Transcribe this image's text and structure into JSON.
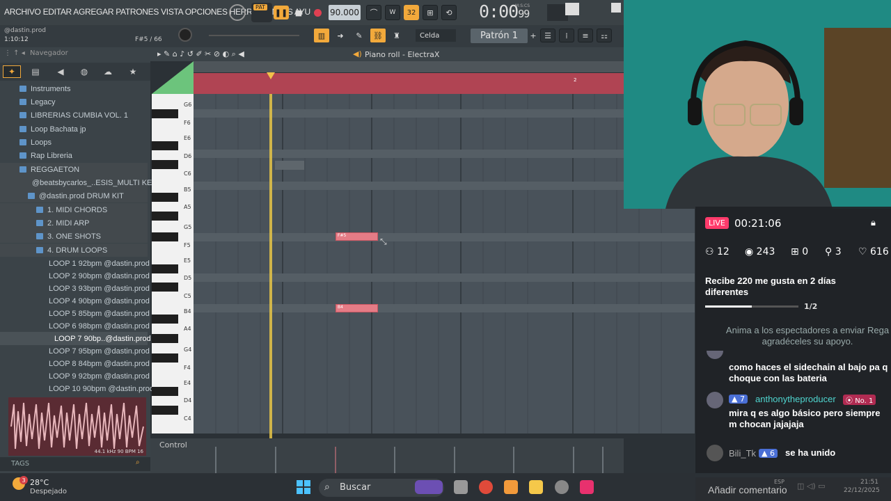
{
  "menubar": {
    "menu_text": "ARCHIVO EDITAR AGREGAR PATRONES VISTA OPCIONES HERRAMIENTAS AYU",
    "pat_label": "PAT",
    "tempo": "90.000",
    "time": "0:00",
    "time_frac": "99",
    "time_unit": "M:S:CS"
  },
  "hint": {
    "title": "@dastin.prod",
    "position": "1:10:12",
    "key": "F#5 / 66"
  },
  "toolbar2": {
    "snap": "Celda",
    "pattern": "Patrón 1"
  },
  "browser": {
    "title": "Navegador",
    "items": [
      {
        "label": "Instruments"
      },
      {
        "label": "Legacy"
      },
      {
        "label": "LIBRERIAS CUMBIA VOL. 1"
      },
      {
        "label": "Loop Bachata jp"
      },
      {
        "label": "Loops"
      },
      {
        "label": "Rap Libreria"
      },
      {
        "label": "REGGAETON"
      },
      {
        "label": "@beatsbycarlos_..ESIS_MULTI KEY"
      },
      {
        "label": "@dastin.prod DRUM KIT"
      },
      {
        "label": "1. MIDI CHORDS"
      },
      {
        "label": "2. MIDI ARP"
      },
      {
        "label": "3. ONE SHOTS"
      },
      {
        "label": "4. DRUM LOOPS"
      },
      {
        "label": "LOOP 1 92bpm @dastin.prod"
      },
      {
        "label": "LOOP 2 90bpm @dastin.prod"
      },
      {
        "label": "LOOP 3 93bpm @dastin.prod"
      },
      {
        "label": "LOOP 4 90bpm @dastin.prod"
      },
      {
        "label": "LOOP 5 85bpm @dastin.prod"
      },
      {
        "label": "LOOP 6 98bpm @dastin.prod"
      },
      {
        "label": "LOOP 7 90bp..@dastin.prod"
      },
      {
        "label": "LOOP 7 95bpm @dastin.prod"
      },
      {
        "label": "LOOP 8 84bpm @dastin.prod"
      },
      {
        "label": "LOOP 9 92bpm @dastin.prod"
      },
      {
        "label": "LOOP 10 90bpm @dastin.prod"
      }
    ],
    "wave_info": "44.1 kHz 90 BPM 16",
    "tags_label": "TAGS"
  },
  "piano_roll": {
    "title": "Piano roll - ElectraX",
    "bar_marker": "2",
    "key_labels": [
      "G6",
      "F6",
      "E6",
      "D6",
      "C6",
      "B5",
      "A5",
      "G5",
      "F5",
      "E5",
      "D5",
      "C5",
      "B4",
      "A4",
      "G4",
      "F4",
      "E4",
      "D4",
      "C4"
    ],
    "notes": [
      {
        "label": "F#5"
      },
      {
        "label": "B4"
      }
    ],
    "control_label": "Control"
  },
  "live": {
    "badge": "LIVE",
    "time": "00:21:06",
    "viewers_online": "12",
    "views": "243",
    "gifts": "0",
    "follows": "3",
    "likes": "616",
    "goal_title": "Recibe 220 me gusta en 2 días diferentes",
    "goal_progress": 0.5,
    "goal_count": "1/2",
    "invite_text": "Anima a los espectadores a enviar Rega agradéceles su apoyo.",
    "comments": [
      {
        "user": "",
        "text": "como haces el sidechain al bajo pa q choque con las bateria"
      },
      {
        "user": "anthonytheproducer",
        "level": "7",
        "rank": "No. 1",
        "text": "mira q es algo básico pero siempre m chocan jajajaja"
      },
      {
        "user": "Bili_Tk",
        "level": "6",
        "text": "se ha unido"
      }
    ],
    "input_placeholder": "Añadir comentario"
  },
  "taskbar": {
    "temp": "28°C",
    "weather": "Despejado",
    "badge": "3",
    "search": "Buscar",
    "lang": "ESP",
    "time": "21:51",
    "date": "22/12/2025"
  }
}
